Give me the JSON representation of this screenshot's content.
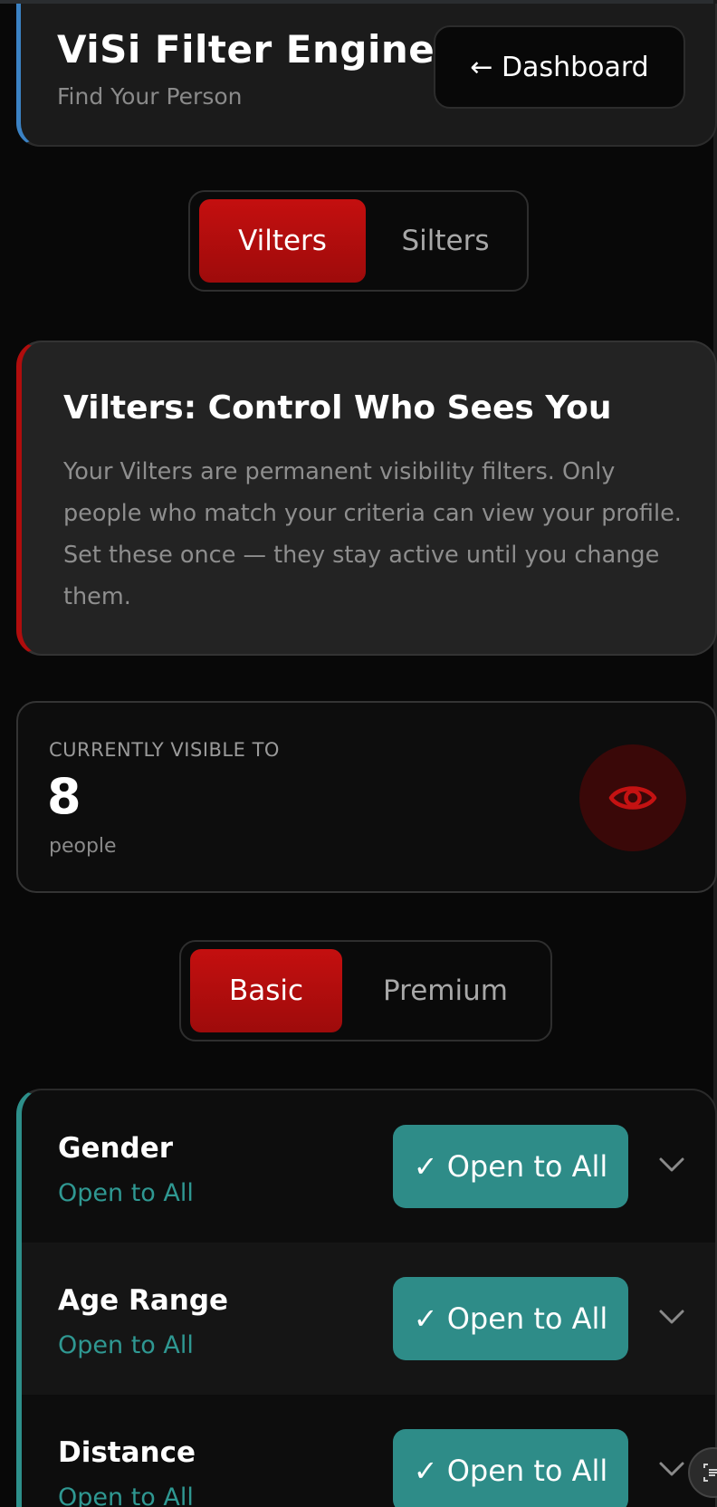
{
  "header": {
    "title": "ViSi Filter Engine",
    "subtitle": "Find Your Person",
    "dashboard_button": "← Dashboard"
  },
  "mode_toggle": {
    "options": [
      "Vilters",
      "Silters"
    ],
    "selected": "Vilters"
  },
  "info_card": {
    "title": "Vilters: Control Who Sees You",
    "description": "Your Vilters are permanent visibility filters. Only people who match your criteria can view your profile. Set these once — they stay active until you change them."
  },
  "visibility": {
    "label": "CURRENTLY VISIBLE TO",
    "count": "8",
    "unit": "people",
    "icon": "eye-icon"
  },
  "tier_toggle": {
    "options": [
      "Basic",
      "Premium"
    ],
    "selected": "Basic"
  },
  "filters": [
    {
      "title": "Gender",
      "value": "Open to All",
      "button": "✓ Open to All"
    },
    {
      "title": "Age Range",
      "value": "Open to All",
      "button": "✓ Open to All"
    },
    {
      "title": "Distance",
      "value": "Open to All",
      "button": "✓ Open to All"
    }
  ],
  "colors": {
    "accent_red": "#b00d0d",
    "accent_teal": "#2e8c88",
    "header_accent": "#3b82c4",
    "background": "#080808"
  }
}
